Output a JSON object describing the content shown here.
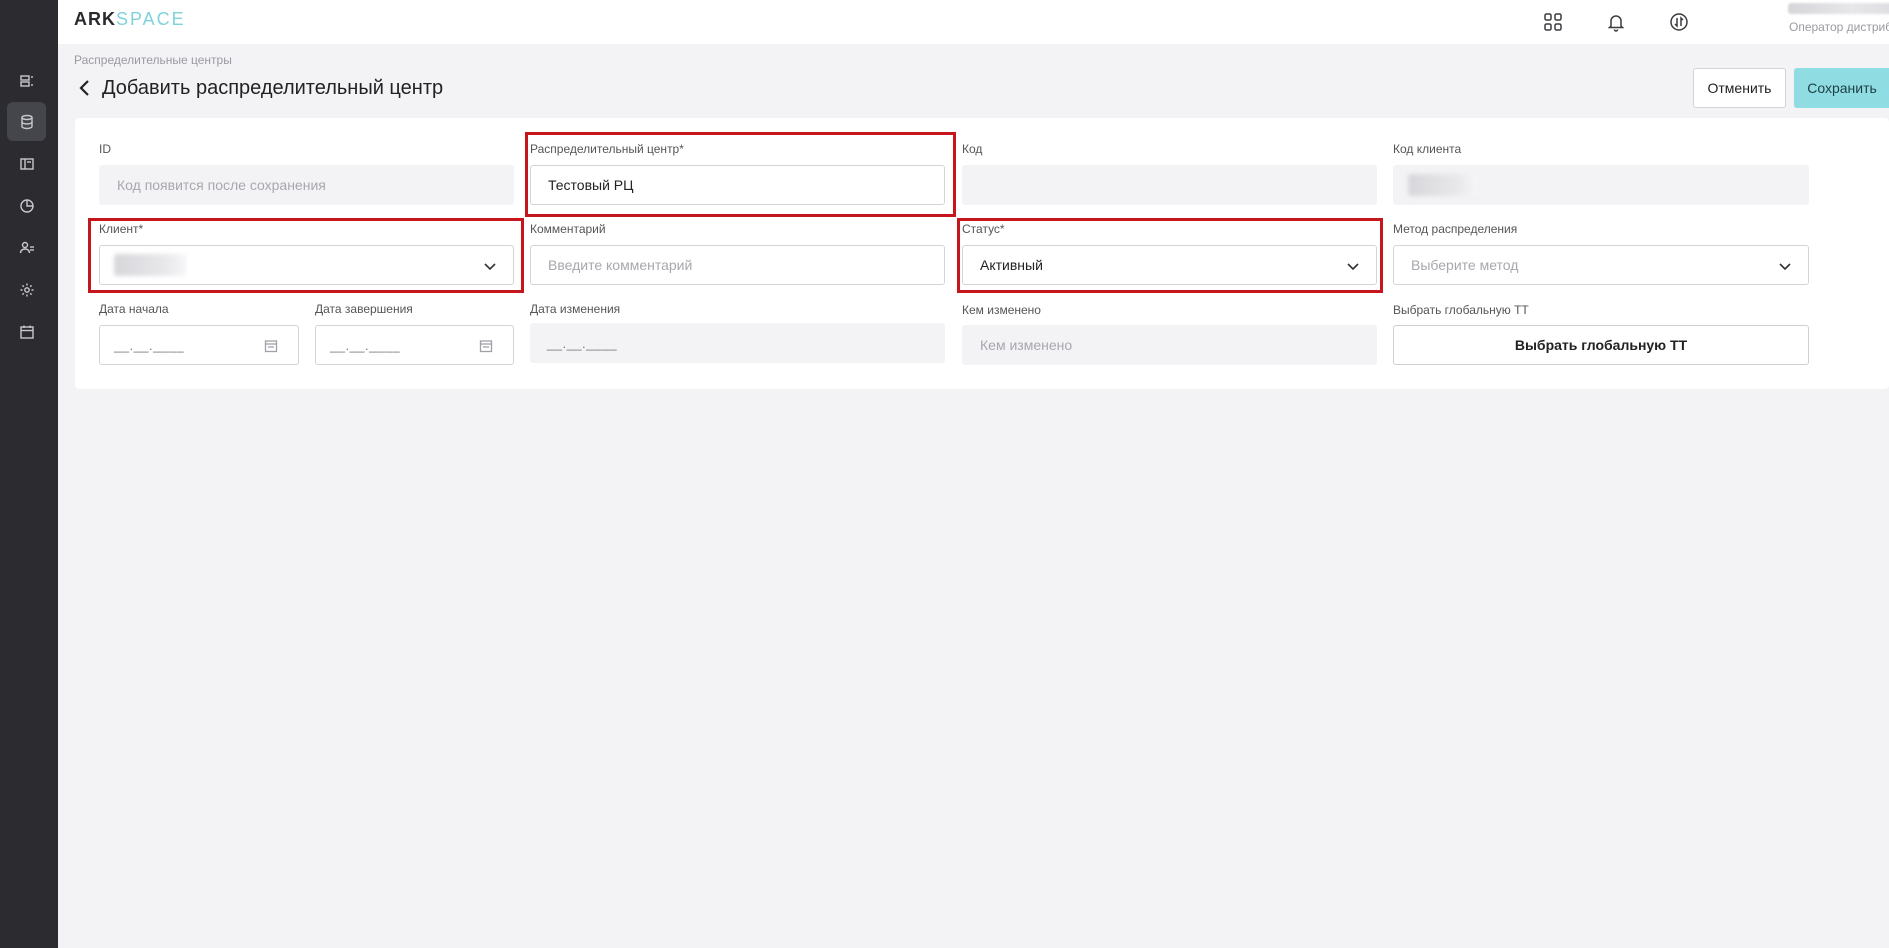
{
  "app": {
    "logo_part1": "ARK",
    "logo_part2": "SPACE",
    "brand_color": "#8fdde3"
  },
  "sidebar": {
    "items": [
      {
        "name": "list-icon",
        "active": false
      },
      {
        "name": "database-icon",
        "active": true
      },
      {
        "name": "book-icon",
        "active": false
      },
      {
        "name": "chart-icon",
        "active": false
      },
      {
        "name": "users-icon",
        "active": false
      },
      {
        "name": "gear-icon",
        "active": false
      },
      {
        "name": "calendar-icon",
        "active": false
      }
    ]
  },
  "topbar": {
    "icons": [
      "apps-grid-icon",
      "bell-icon",
      "sync-icon"
    ],
    "user_role": "Оператор дистрибу..."
  },
  "header": {
    "breadcrumb": "Распределительные центры",
    "title": "Добавить распределительный центр",
    "cancel_label": "Отменить",
    "save_label": "Сохранить"
  },
  "form": {
    "id": {
      "label": "ID",
      "placeholder": "Код появится после сохранения"
    },
    "dc": {
      "label": "Распределительный центр*",
      "value": "Тестовый РЦ"
    },
    "code": {
      "label": "Код",
      "value": ""
    },
    "client_code": {
      "label": "Код клиента"
    },
    "client": {
      "label": "Клиент*"
    },
    "comment": {
      "label": "Комментарий",
      "placeholder": "Введите комментарий"
    },
    "status": {
      "label": "Статус*",
      "value": "Активный"
    },
    "method": {
      "label": "Метод распределения",
      "placeholder": "Выберите метод"
    },
    "start_date": {
      "label": "Дата начала",
      "mask": "__.__.____"
    },
    "end_date": {
      "label": "Дата завершения",
      "mask": "__.__.____"
    },
    "modified_date": {
      "label": "Дата изменения",
      "mask": "__.__.____"
    },
    "modified_by": {
      "label": "Кем изменено",
      "placeholder": "Кем изменено"
    },
    "global_tt": {
      "label": "Выбрать глобальную ТТ",
      "button": "Выбрать глобальную ТТ"
    }
  },
  "highlight_color": "#c4161c"
}
